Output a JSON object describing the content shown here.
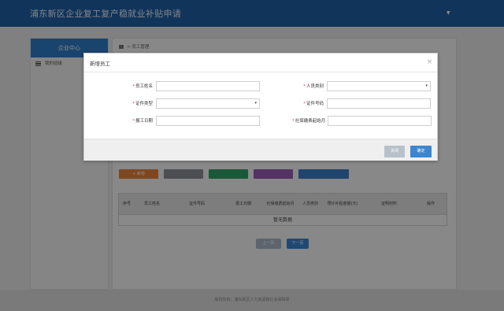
{
  "header": {
    "title": "浦东新区企业复工复产稳就业补贴申请"
  },
  "sidebar": {
    "heading": "企业中心",
    "items": [
      {
        "label": "我的班级"
      }
    ]
  },
  "main": {
    "breadcrumb": "> 员工管理",
    "action_buttons": [
      "+ 新增",
      "",
      "",
      "",
      ""
    ],
    "table": {
      "columns": [
        "序号",
        "员工姓名",
        "证件号码",
        "报工日期",
        "社保缴费起始月",
        "人员类别",
        "预计补贴金额(元)",
        "证明材料",
        "操作"
      ],
      "empty_text": "暂无数据"
    },
    "pager": {
      "prev": "上一页",
      "next": "下一页"
    }
  },
  "footer": {
    "text": "版权所有：浦东新区人力资源和社会保障局"
  },
  "modal": {
    "title": "新增员工",
    "fields": {
      "name": {
        "label": "员工姓名",
        "value": ""
      },
      "category": {
        "label": "人员类别",
        "value": ""
      },
      "id_type": {
        "label": "证件类型",
        "value": ""
      },
      "id_number": {
        "label": "证件号码",
        "value": ""
      },
      "report_date": {
        "label": "报工日期",
        "value": ""
      },
      "social_start": {
        "label": "社保缴费起始月",
        "value": ""
      }
    },
    "buttons": {
      "cancel": "关闭",
      "ok": "确定"
    }
  },
  "colors": {
    "header": "#1f5fa6",
    "primary": "#3a86d0",
    "required": "#e03a3a"
  }
}
